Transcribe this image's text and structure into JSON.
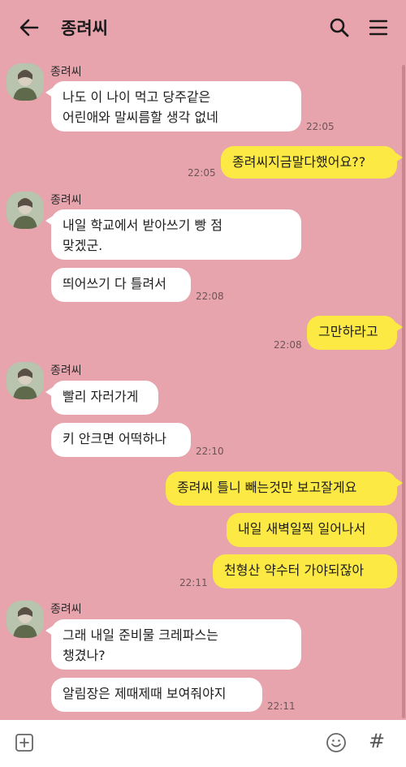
{
  "header": {
    "title": "종려씨",
    "back_icon": "arrow-left-icon",
    "search_icon": "search-icon",
    "menu_icon": "hamburger-menu-icon"
  },
  "messages": [
    {
      "sender": "종려씨",
      "lines": [
        "나도 이 나이 먹고 당주같은",
        "어린애와 말씨름할 생각 없네"
      ],
      "time": "22:05"
    },
    {
      "mine": true,
      "text": "종려씨지금말다했어요??",
      "time": "22:05"
    },
    {
      "sender": "종려씨",
      "lines": [
        "내일 학교에서 받아쓰기 빵 점",
        "맞겠군."
      ]
    },
    {
      "text": "띄어쓰기 다 틀려서",
      "time": "22:08"
    },
    {
      "mine": true,
      "text": "그만하라고",
      "time": "22:08"
    },
    {
      "sender": "종려씨",
      "text": "빨리 자러가게"
    },
    {
      "text": "키 안크면 어떡하나",
      "time": "22:10"
    },
    {
      "mine": true,
      "text": "종려씨 틀니 빼는것만 보고잘게요"
    },
    {
      "mine": true,
      "text": "내일 새벽일찍 일어나서"
    },
    {
      "mine": true,
      "text": "천형산 약수터 가야되잖아",
      "time": "22:11"
    },
    {
      "sender": "종려씨",
      "lines": [
        "그래 내일 준비물 크레파스는",
        "챙겼나?"
      ]
    },
    {
      "text": "알림장은 제때제때 보여줘야지",
      "time": "22:11"
    }
  ],
  "input_bar": {
    "plus_icon": "plus-square-icon",
    "emoji_icon": "smiley-icon",
    "hash_label": "#"
  },
  "colors": {
    "background": "#e8a4ad",
    "my_bubble": "#fde943",
    "their_bubble": "#ffffff"
  }
}
